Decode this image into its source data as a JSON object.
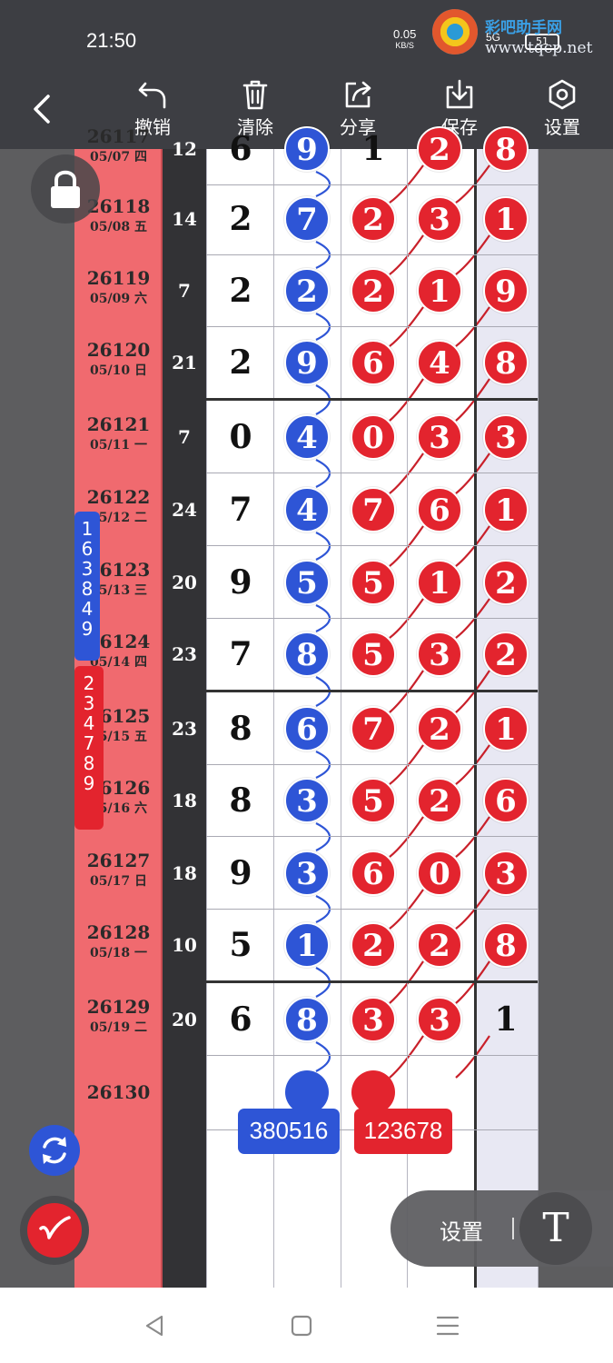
{
  "status_bar": {
    "time": "21:50",
    "speed_value": "0.05",
    "speed_unit": "KB/S",
    "signal": "5G",
    "battery": "51"
  },
  "watermark": {
    "site_cn": "彩吧助手网",
    "site_url": "www.tqcp.net"
  },
  "toolbar": {
    "undo": "撤销",
    "clear": "清除",
    "share": "分享",
    "save": "保存",
    "settings": "设置"
  },
  "rows": [
    {
      "issue": "26117",
      "date": "05/07 四",
      "sum": "12",
      "h": "6",
      "b": "9",
      "r1": "1",
      "r2": "2",
      "r3": "8",
      "r1_ball": false,
      "r2_ball": true,
      "r3_ball": true
    },
    {
      "issue": "26118",
      "date": "05/08 五",
      "sum": "14",
      "h": "2",
      "b": "7",
      "r1": "2",
      "r2": "3",
      "r3": "1",
      "r1_ball": true,
      "r2_ball": true,
      "r3_ball": true
    },
    {
      "issue": "26119",
      "date": "05/09 六",
      "sum": "7",
      "h": "2",
      "b": "2",
      "r1": "2",
      "r2": "1",
      "r3": "9",
      "r1_ball": true,
      "r2_ball": true,
      "r3_ball": true
    },
    {
      "issue": "26120",
      "date": "05/10 日",
      "sum": "21",
      "h": "2",
      "b": "9",
      "r1": "6",
      "r2": "4",
      "r3": "8",
      "r1_ball": true,
      "r2_ball": true,
      "r3_ball": true
    },
    {
      "issue": "26121",
      "date": "05/11 一",
      "sum": "7",
      "h": "0",
      "b": "4",
      "r1": "0",
      "r2": "3",
      "r3": "3",
      "r1_ball": true,
      "r2_ball": true,
      "r3_ball": true
    },
    {
      "issue": "26122",
      "date": "05/12 二",
      "sum": "24",
      "h": "7",
      "b": "4",
      "r1": "7",
      "r2": "6",
      "r3": "1",
      "r1_ball": true,
      "r2_ball": true,
      "r3_ball": true
    },
    {
      "issue": "26123",
      "date": "05/13 三",
      "sum": "20",
      "h": "9",
      "b": "5",
      "r1": "5",
      "r2": "1",
      "r3": "2",
      "r1_ball": true,
      "r2_ball": true,
      "r3_ball": true
    },
    {
      "issue": "26124",
      "date": "05/14 四",
      "sum": "23",
      "h": "7",
      "b": "8",
      "r1": "5",
      "r2": "3",
      "r3": "2",
      "r1_ball": true,
      "r2_ball": true,
      "r3_ball": true
    },
    {
      "issue": "26125",
      "date": "05/15 五",
      "sum": "23",
      "h": "8",
      "b": "6",
      "r1": "7",
      "r2": "2",
      "r3": "1",
      "r1_ball": true,
      "r2_ball": true,
      "r3_ball": true
    },
    {
      "issue": "26126",
      "date": "05/16 六",
      "sum": "18",
      "h": "8",
      "b": "3",
      "r1": "5",
      "r2": "2",
      "r3": "6",
      "r1_ball": true,
      "r2_ball": true,
      "r3_ball": true
    },
    {
      "issue": "26127",
      "date": "05/17 日",
      "sum": "18",
      "h": "9",
      "b": "3",
      "r1": "6",
      "r2": "0",
      "r3": "3",
      "r1_ball": true,
      "r2_ball": true,
      "r3_ball": true
    },
    {
      "issue": "26128",
      "date": "05/18 一",
      "sum": "10",
      "h": "5",
      "b": "1",
      "r1": "2",
      "r2": "2",
      "r3": "8",
      "r1_ball": true,
      "r2_ball": true,
      "r3_ball": true
    },
    {
      "issue": "26129",
      "date": "05/19 二",
      "sum": "20",
      "h": "6",
      "b": "8",
      "r1": "3",
      "r2": "3",
      "r3": "1",
      "r1_ball": true,
      "r2_ball": true,
      "r3_ball": false
    },
    {
      "issue": "26130",
      "date": "",
      "sum": "",
      "h": "",
      "b": "",
      "r1": "",
      "r2": "",
      "r3": ""
    }
  ],
  "blue_digits": "163849",
  "red_digits": "234789",
  "blue_tag": "380516",
  "red_tag": "123678",
  "float_bar": {
    "settings": "设置",
    "text_tool": "T"
  },
  "colors": {
    "blue": "#2e55d6",
    "red": "#e3242e",
    "date_column": "#f06a6f"
  }
}
